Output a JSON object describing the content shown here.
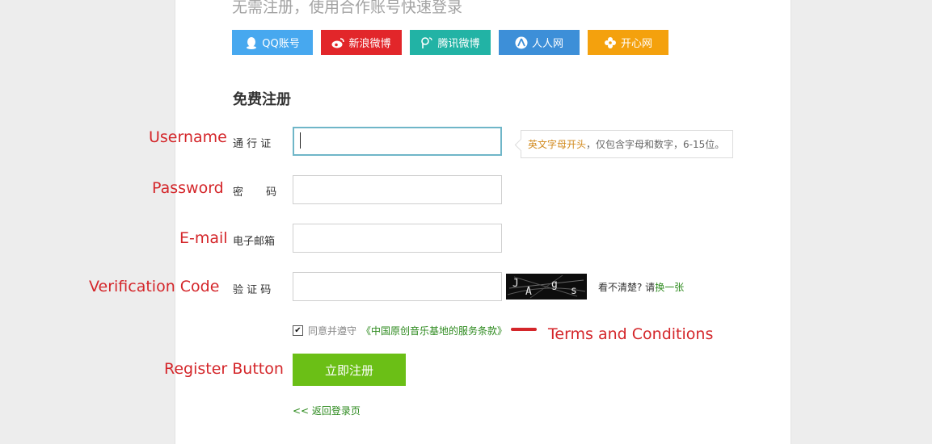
{
  "header": {
    "hint": "无需注册，使用合作账号快速登录"
  },
  "social_logins": [
    {
      "label": "QQ账号",
      "icon": "qq-icon",
      "color": "#47a8ef"
    },
    {
      "label": "新浪微博",
      "icon": "weibo-icon",
      "color": "#e2262a"
    },
    {
      "label": "腾讯微博",
      "icon": "tencent-weibo-icon",
      "color": "#22b3a5"
    },
    {
      "label": "人人网",
      "icon": "renren-icon",
      "color": "#3d8fd8"
    },
    {
      "label": "开心网",
      "icon": "kaixin-icon",
      "color": "#f4a10d"
    }
  ],
  "form": {
    "title": "免费注册",
    "username": {
      "label": "通 行 证",
      "value": ""
    },
    "password": {
      "label": "密 码",
      "value": ""
    },
    "email": {
      "label": "电子邮箱",
      "value": ""
    },
    "captcha": {
      "label": "验 证 码",
      "value": "",
      "image_text": "JAgs"
    },
    "username_tip": {
      "highlight": "英文字母开头",
      "rest": "，仅包含字母和数字，6-15位。"
    },
    "captcha_hint": {
      "text": "看不清楚? 请",
      "link": "换一张"
    },
    "agree": {
      "checked": true,
      "text": "同意并遵守",
      "terms": "《中国原创音乐基地的服务条款》"
    },
    "submit_label": "立即注册",
    "back_link": "<< 返回登录页"
  },
  "annotations": {
    "username": "Username",
    "password": "Password",
    "email": "E-mail",
    "captcha": "Verification Code",
    "terms": "Terms and Conditions",
    "register": "Register Button"
  },
  "colors": {
    "accent_green": "#6bbf16",
    "link_green": "#2d8a1e",
    "annotation_red": "#d4262a",
    "focus_border": "#6fb6c8"
  }
}
